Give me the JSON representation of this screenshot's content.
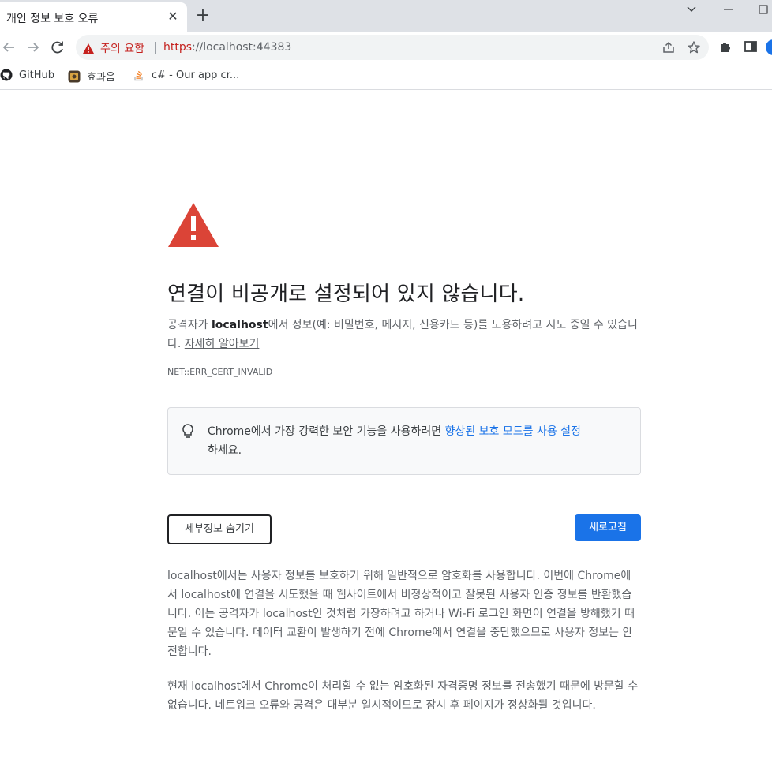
{
  "tab": {
    "title": "개인 정보 보호 오류",
    "close": "✕",
    "new_tab": "+"
  },
  "toolbar": {
    "security_label": "주의 요함",
    "url_scheme": "https",
    "url_rest": "://localhost:44383"
  },
  "bookmarks": [
    {
      "label": "GitHub",
      "icon": "github-icon"
    },
    {
      "label": "효과음",
      "icon": "sound-effects-icon"
    },
    {
      "label": "c# - Our app cr...",
      "icon": "stackoverflow-icon"
    }
  ],
  "interstitial": {
    "heading": "연결이 비공개로 설정되어 있지 않습니다.",
    "message_pre": "공격자가 ",
    "message_host": "localhost",
    "message_post": "에서 정보(예: 비밀번호, 메시지, 신용카드 등)를 도용하려고 시도 중일 수 있습니다. ",
    "learn_more": "자세히 알아보기",
    "error_code": "NET::ERR_CERT_INVALID",
    "promo_pre": "Chrome에서 가장 강력한 보안 기능을 사용하려면 ",
    "promo_link": "향상된 보호 모드를 사용 설정",
    "promo_post": "하세요.",
    "details_button": "세부정보 숨기기",
    "reload_button": "새로고침",
    "details_paragraph_1": "localhost에서는 사용자 정보를 보호하기 위해 일반적으로 암호화를 사용합니다. 이번에 Chrome에서 localhost에 연결을 시도했을 때 웹사이트에서 비정상적이고 잘못된 사용자 인증 정보를 반환했습니다. 이는 공격자가 localhost인 것처럼 가장하려고 하거나 Wi-Fi 로그인 화면이 연결을 방해했기 때문일 수 있습니다. 데이터 교환이 발생하기 전에 Chrome에서 연결을 중단했으므로 사용자 정보는 안전합니다.",
    "details_paragraph_2": "현재 localhost에서 Chrome이 처리할 수 없는 암호화된 자격증명 정보를 전송했기 때문에 방문할 수 없습니다. 네트워크 오류와 공격은 대부분 일시적이므로 잠시 후 페이지가 정상화될 것입니다."
  },
  "colors": {
    "danger": "#c5221f",
    "warning_icon": "#db4437",
    "accent": "#1a73e8",
    "tabstrip": "#dee1e6"
  }
}
